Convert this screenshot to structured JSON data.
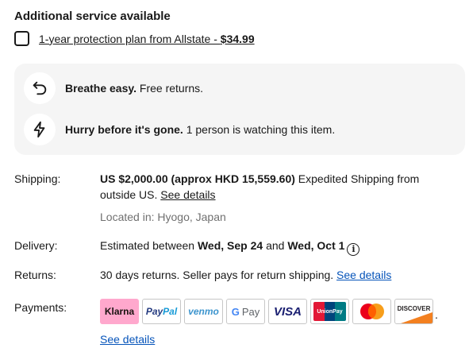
{
  "additional_service": {
    "title": "Additional service available",
    "plan_text": "1-year protection plan from Allstate - ",
    "plan_price": "$34.99"
  },
  "info_box": {
    "returns_bold": "Breathe easy.",
    "returns_text": " Free returns.",
    "watching_bold": "Hurry before it's gone.",
    "watching_text": " 1 person is watching this item."
  },
  "shipping": {
    "label": "Shipping:",
    "price_bold": "US $2,000.00 (approx HKD 15,559.60)",
    "method_text": " Expedited Shipping from outside US. ",
    "details_link": "See details",
    "location": "Located in: Hyogo, Japan"
  },
  "delivery": {
    "label": "Delivery:",
    "prefix": "Estimated between ",
    "start_date": "Wed, Sep 24",
    "middle": " and ",
    "end_date": "Wed, Oct 1",
    "info_glyph": "i"
  },
  "returns": {
    "label": "Returns:",
    "text": "30 days returns. Seller pays for return shipping. ",
    "details_link": "See details"
  },
  "payments": {
    "label": "Payments:",
    "methods": [
      "Klarna",
      "PayPal",
      "venmo",
      "G Pay",
      "VISA",
      "UnionPay",
      "Mastercard",
      "DISCOVER"
    ],
    "trailing_dot": ".",
    "details_link": "See details"
  },
  "colors": {
    "info_box_bg": "#f5f5f5",
    "link_blue": "#0654ba",
    "klarna_pink": "#ffa8cd",
    "mastercard_red": "#eb001b",
    "mastercard_orange": "#f79e1b"
  },
  "icons": [
    "return-arrow-icon",
    "lightning-icon",
    "info-circle-icon"
  ]
}
